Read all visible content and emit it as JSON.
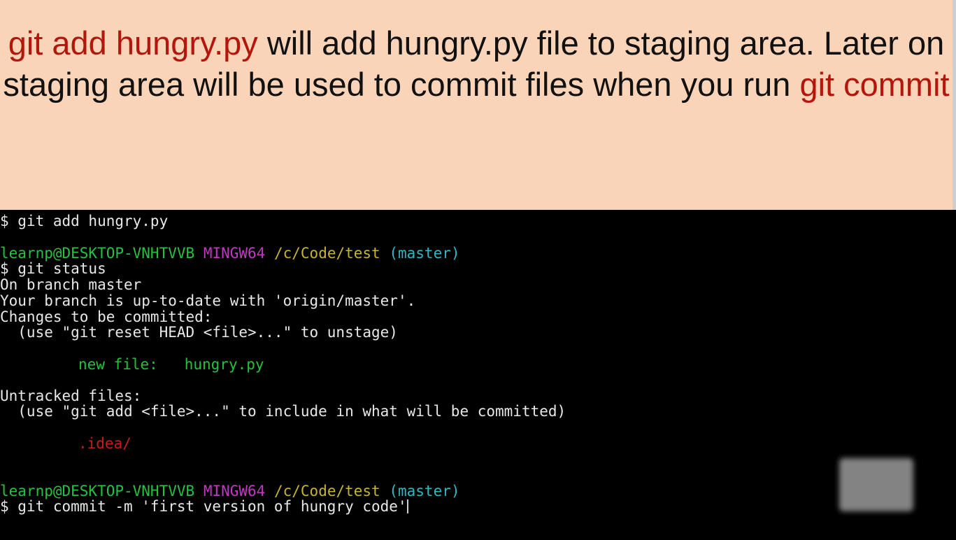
{
  "caption": {
    "part1_highlight": "git add hungry.py",
    "part2": " will add hungry.py file to staging area. Later on staging area will be used to commit files when you run ",
    "part3_highlight": "git commit"
  },
  "terminal": {
    "cmd1": "$ git add hungry.py",
    "prompt1": {
      "user": "learnp@DESKTOP-VNHTVVB",
      "shell": "MINGW64",
      "path": "/c/Code/test",
      "branch": "(master)"
    },
    "cmd2": "$ git status",
    "status_lines": [
      "On branch master",
      "Your branch is up-to-date with 'origin/master'.",
      "Changes to be committed:",
      "  (use \"git reset HEAD <file>...\" to unstage)"
    ],
    "staged_label": "new file:",
    "staged_file": "hungry.py",
    "untracked_header": "Untracked files:",
    "untracked_hint": "  (use \"git add <file>...\" to include in what will be committed)",
    "untracked_file": ".idea/",
    "prompt2": {
      "user": "learnp@DESKTOP-VNHTVVB",
      "shell": "MINGW64",
      "path": "/c/Code/test",
      "branch": "(master)"
    },
    "cmd3": "$ git commit -m 'first version of hungry code'"
  },
  "colors": {
    "banner_bg": "#f9d4b8",
    "highlight_red": "#b3170c",
    "prompt_green": "#25c241",
    "prompt_magenta": "#c238c2",
    "prompt_yellow": "#c6b531",
    "prompt_cyan": "#2fb7c4"
  }
}
